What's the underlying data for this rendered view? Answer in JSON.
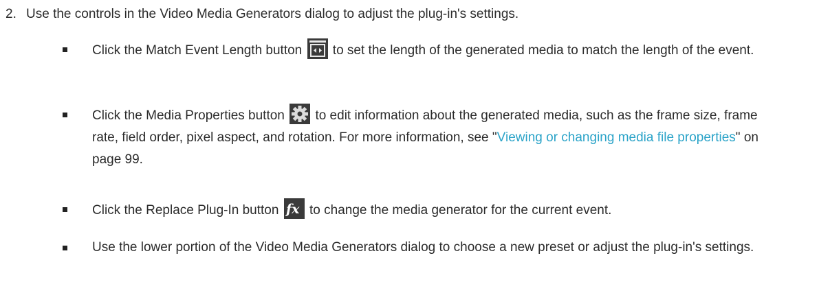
{
  "step": {
    "number": "2.",
    "text": "Use the controls in the Video Media Generators dialog to adjust the plug-in's settings."
  },
  "bullets": [
    {
      "before": "Click the Match Event Length button",
      "icon": "match-event-length-icon",
      "after": "to set the length of the generated media to match the length of the event."
    },
    {
      "before": "Click the Media Properties button",
      "icon": "gear-icon",
      "after": "to edit information about the generated media, such as the frame size, frame rate, field order, pixel aspect, and rotation. For more information, see \"",
      "link": "Viewing or changing media file properties",
      "tail": "\" on page 99."
    },
    {
      "before": "Click the Replace Plug-In button",
      "icon": "fx-icon",
      "after": "to change the media generator for the current event."
    },
    {
      "text": "Use the lower portion of the Video Media Generators dialog to choose a new preset or adjust the plug-in's settings."
    }
  ],
  "colors": {
    "text": "#2b2b2b",
    "link": "#2aa3c8",
    "icon_background": "#3a3a3a"
  }
}
